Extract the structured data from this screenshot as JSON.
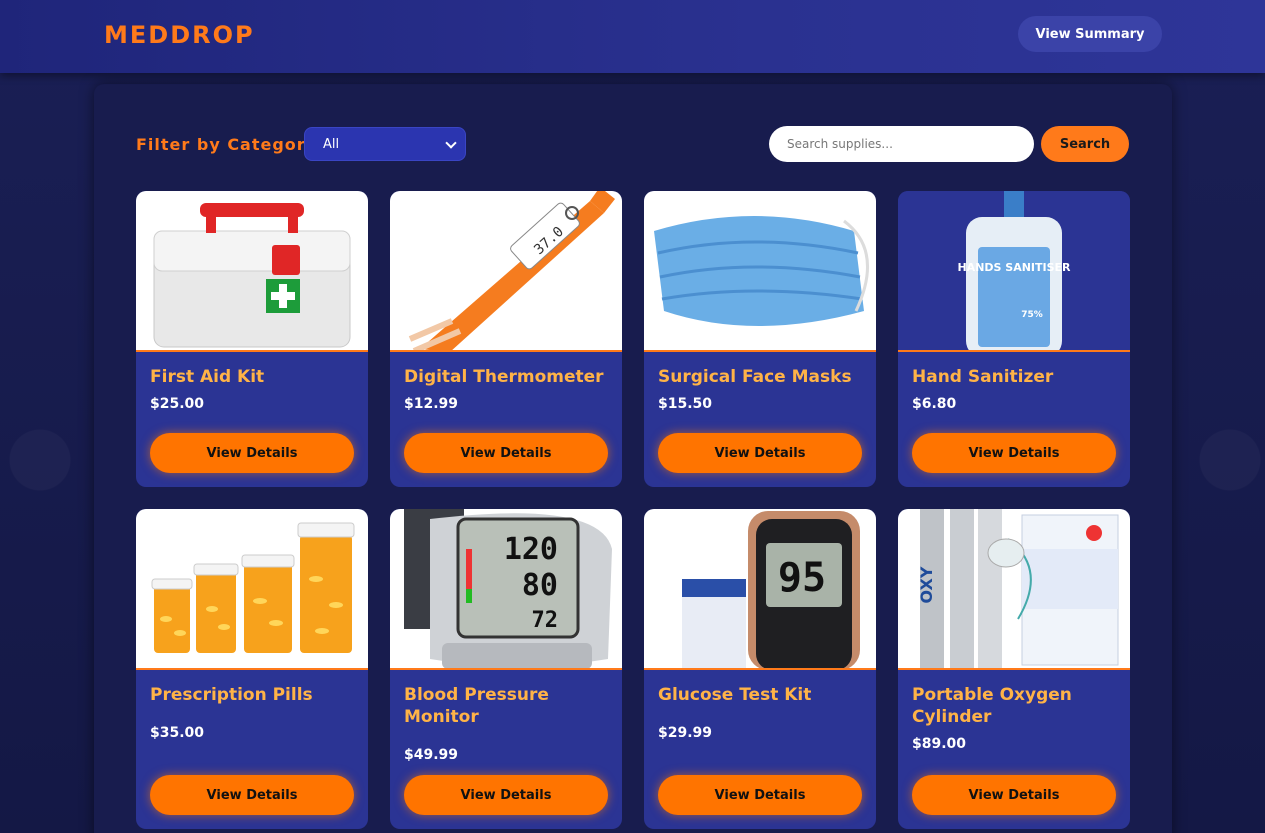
{
  "header": {
    "logo": "MEDDROP",
    "summary_button": "View Summary"
  },
  "filters": {
    "label": "Filter by Category",
    "selected": "All",
    "search_placeholder": "Search supplies...",
    "search_button": "Search"
  },
  "products": [
    {
      "name": "First Aid Kit",
      "price": "$25.00",
      "button": "View Details"
    },
    {
      "name": "Digital Thermometer",
      "price": "$12.99",
      "button": "View Details"
    },
    {
      "name": "Surgical Face Masks",
      "price": "$15.50",
      "button": "View Details"
    },
    {
      "name": "Hand Sanitizer",
      "price": "$6.80",
      "button": "View Details"
    },
    {
      "name": "Prescription Pills",
      "price": "$35.00",
      "button": "View Details"
    },
    {
      "name": "Blood Pressure Monitor",
      "price": "$49.99",
      "button": "View Details"
    },
    {
      "name": "Glucose Test Kit",
      "price": "$29.99",
      "button": "View Details"
    },
    {
      "name": "Portable Oxygen Cylinder",
      "price": "$89.00",
      "button": "View Details"
    }
  ],
  "image_text": {
    "thermometer": "37.0",
    "sanitizer_title": "HANDS SANITISER",
    "sanitizer_pct": "75%",
    "bp_sys": "120",
    "bp_dia": "80",
    "bp_pul": "72",
    "glucose": "95",
    "oxygen": "OXY"
  }
}
